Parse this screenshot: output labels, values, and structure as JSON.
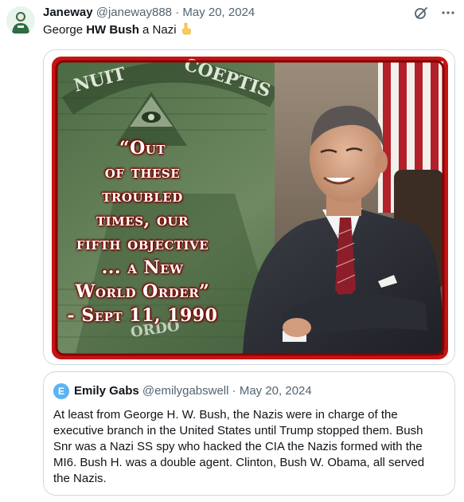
{
  "tweet": {
    "author_name": "Janeway",
    "author_handle": "@janeway888",
    "separator": "·",
    "date": "May 20, 2024",
    "text_prefix": "George ",
    "text_bold": "HW Bush",
    "text_suffix": " a Nazi",
    "emoji": "pointing-down-emoji"
  },
  "top_icons": [
    "grok-icon",
    "more-icon"
  ],
  "media": {
    "overlay_lines": [
      "“Out",
      "of these",
      "troubled",
      "times, our",
      "fifth objective",
      "... a New",
      "World Order”",
      "- Sept 11, 1990"
    ],
    "background_text": [
      "NUIT",
      "COEPTIS",
      "ORDO"
    ],
    "colors": {
      "frame": "#c41414",
      "text_glow": "#8a0000",
      "money_green": "#3f5e3a"
    }
  },
  "quote": {
    "avatar_letter": "E",
    "author_name": "Emily Gabs",
    "author_handle": "@emilygabswell",
    "separator": "·",
    "date": "May 20, 2024",
    "text": "At least from George H. W. Bush, the Nazis were in charge of the executive branch in the United States until Trump stopped them. Bush Snr was a Nazi SS spy who hacked the CIA the Nazis formed with the MI6. Bush H. was a double agent. Clinton, Bush W. Obama, all served the Nazis."
  }
}
